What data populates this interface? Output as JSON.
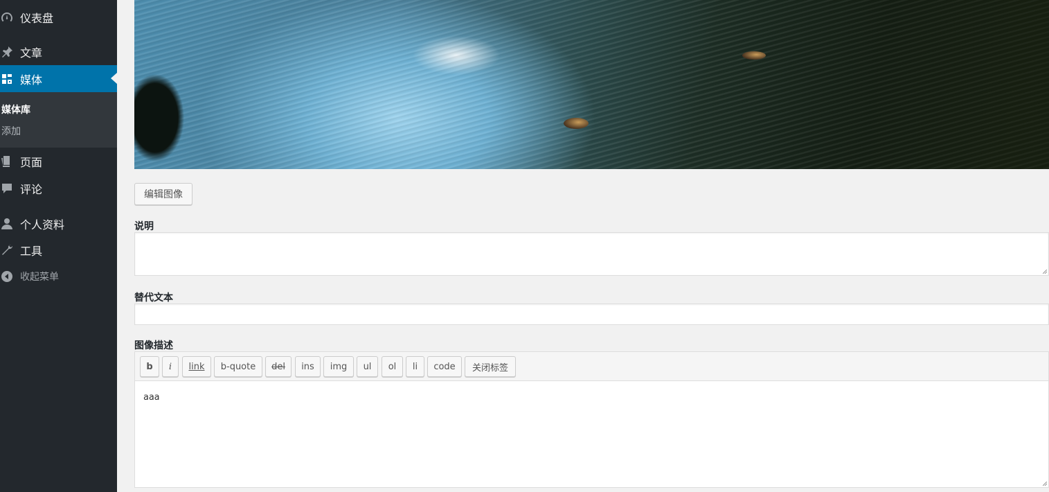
{
  "sidebar": {
    "items": [
      {
        "label": "仪表盘",
        "icon": "dashboard-icon"
      },
      {
        "label": "文章",
        "icon": "pin-icon"
      },
      {
        "label": "媒体",
        "icon": "media-icon"
      },
      {
        "label": "页面",
        "icon": "page-icon"
      },
      {
        "label": "评论",
        "icon": "comment-icon"
      },
      {
        "label": "个人资料",
        "icon": "user-icon"
      },
      {
        "label": "工具",
        "icon": "wrench-icon"
      },
      {
        "label": "收起菜单",
        "icon": "collapse-icon"
      }
    ],
    "submenu": [
      {
        "label": "媒体库"
      },
      {
        "label": "添加"
      }
    ],
    "colors": {
      "bg": "#23282d",
      "active": "#0073aa",
      "submenu_bg": "#32373c"
    }
  },
  "main": {
    "edit_image_label": "编辑图像",
    "caption_label": "说明",
    "caption_value": "",
    "alt_label": "替代文本",
    "alt_value": "",
    "description_label": "图像描述",
    "toolbar": [
      "b",
      "i",
      "link",
      "b-quote",
      "del",
      "ins",
      "img",
      "ul",
      "ol",
      "li",
      "code",
      "关闭标签"
    ],
    "description_value": "aaa"
  }
}
